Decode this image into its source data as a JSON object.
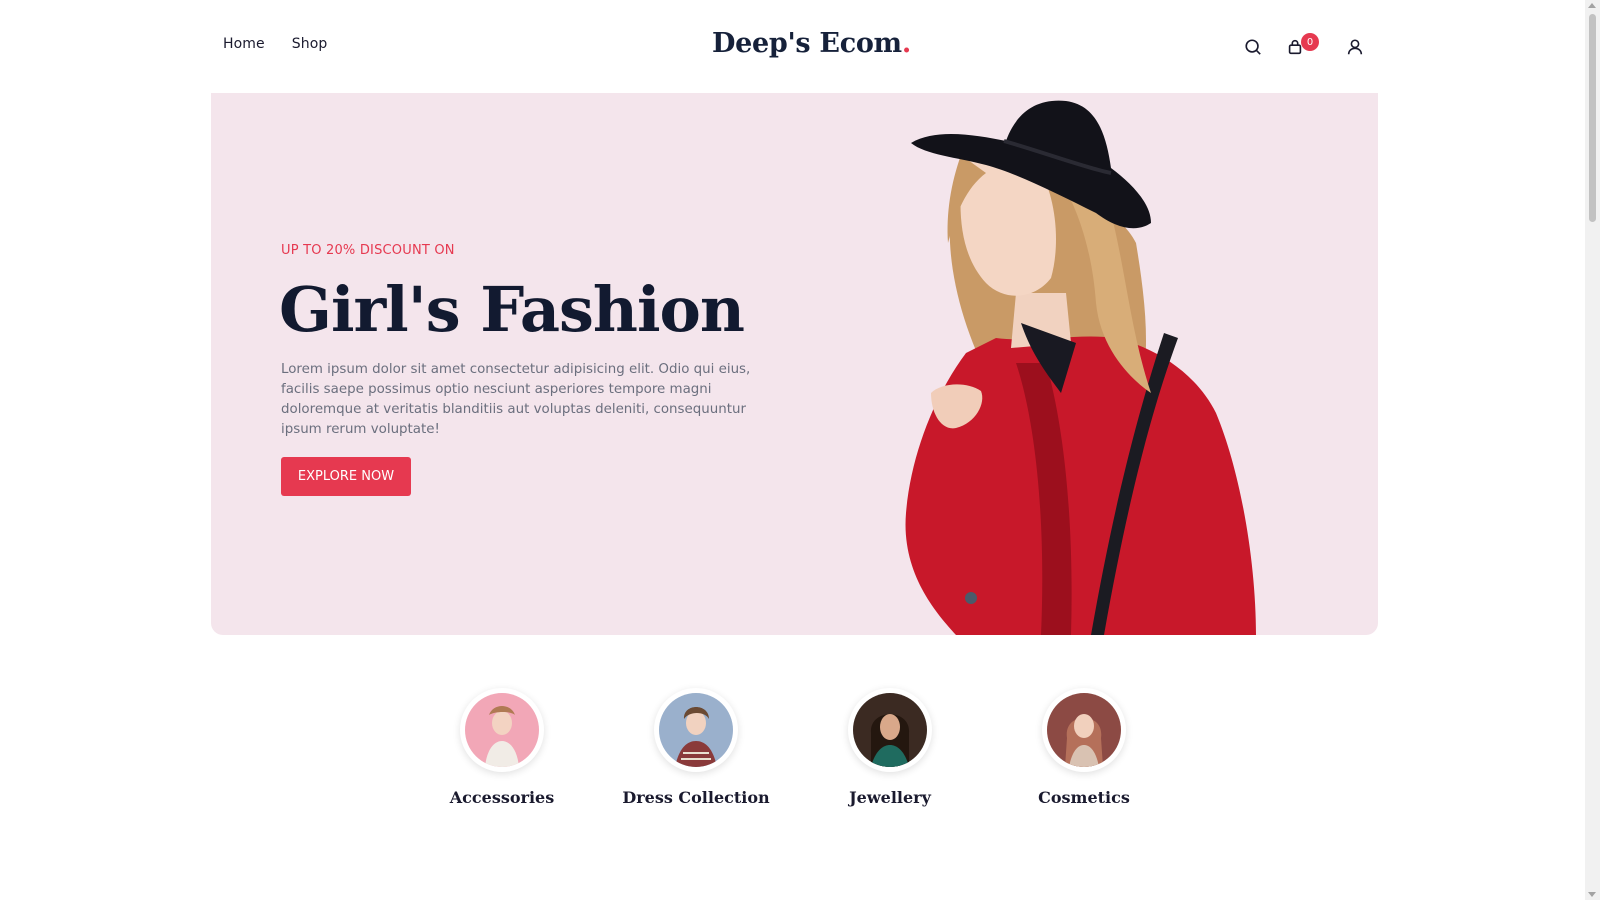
{
  "header": {
    "nav": [
      {
        "label": "Home"
      },
      {
        "label": "Shop"
      }
    ],
    "logo": {
      "text": "Deep's Ecom",
      "dot": "."
    },
    "icons": [
      "search-icon",
      "cart-icon",
      "user-icon"
    ],
    "cart_count": "0"
  },
  "hero": {
    "eyebrow": "UP TO 20% DISCOUNT ON",
    "title": "Girl's Fashion",
    "description": "Lorem ipsum dolor sit amet consectetur adipisicing elit. Odio qui eius, facilis saepe possimus optio nesciunt asperiores tempore magni doloremque at veritatis blanditiis aut voluptas deleniti, consequuntur ipsum rerum voluptate!",
    "cta_label": "EXPLORE NOW",
    "background": "#f4e5ec"
  },
  "categories": [
    {
      "label": "Accessories"
    },
    {
      "label": "Dress Collection"
    },
    {
      "label": "Jewellery"
    },
    {
      "label": "Cosmetics"
    }
  ],
  "colors": {
    "accent": "#e63950",
    "heading": "#121a30",
    "coat": "#c8182a"
  }
}
